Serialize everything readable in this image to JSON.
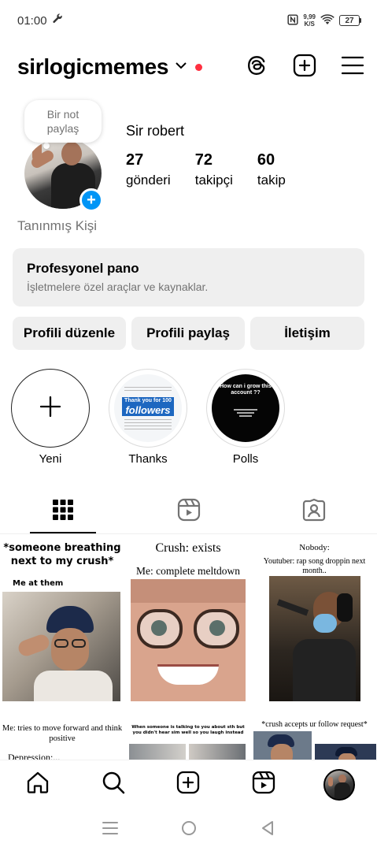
{
  "status": {
    "time": "01:00",
    "net_speed_value": "9,99",
    "net_speed_unit": "K/S",
    "battery": "27"
  },
  "header": {
    "username": "sirlogicmemes"
  },
  "note": {
    "line1": "Bir not",
    "line2": "paylaş"
  },
  "profile": {
    "display_name": "Sir robert",
    "category": "Tanınmış Kişi",
    "stats": [
      {
        "value": "27",
        "label": "gönderi"
      },
      {
        "value": "72",
        "label": "takipçi"
      },
      {
        "value": "60",
        "label": "takip"
      }
    ]
  },
  "pro_dashboard": {
    "title": "Profesyonel pano",
    "subtitle": "İşletmelere özel araçlar ve kaynaklar."
  },
  "actions": {
    "edit": "Profili düzenle",
    "share": "Profili paylaş",
    "contact": "İletişim"
  },
  "highlights": [
    {
      "label": "Yeni"
    },
    {
      "label": "Thanks",
      "cover_small": "Thank you for 100",
      "cover_big": "followers"
    },
    {
      "label": "Polls",
      "cover_text": "How can i grow this account ??"
    }
  ],
  "posts": [
    {
      "top": "*someone breathing next to my crush*",
      "sub": "Me at them"
    },
    {
      "top": "Crush: exists",
      "sub": "Me: complete meltdown"
    },
    {
      "top": "Nobody:",
      "sub": "Youtuber: rap song droppin next month.."
    },
    {
      "top": "Me: tries to move forward and think positive",
      "sub": "Depression:..."
    },
    {
      "top": "When someone is talking to you about sth but you didn't hear sim well so you laugh instead"
    },
    {
      "top": "*crush accepts ur follow request*"
    }
  ]
}
